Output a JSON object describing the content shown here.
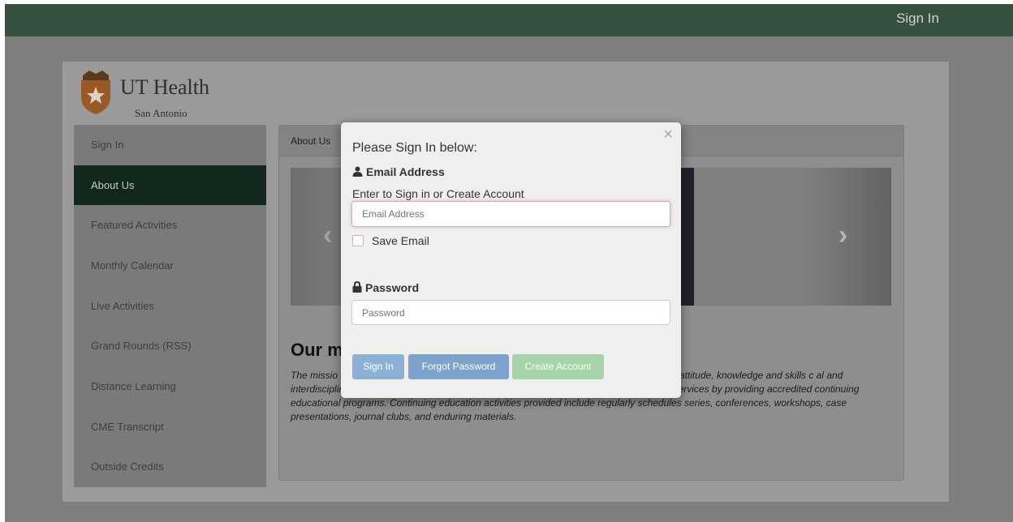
{
  "topbar": {
    "signin_label": "Sign In"
  },
  "logo": {
    "title": "UT Health",
    "subtitle": "San Antonio"
  },
  "sidebar": {
    "items": [
      {
        "label": "Sign In",
        "active": false
      },
      {
        "label": "About Us",
        "active": true
      },
      {
        "label": "Featured Activities",
        "active": false
      },
      {
        "label": "Monthly Calendar",
        "active": false
      },
      {
        "label": "Live Activities",
        "active": false
      },
      {
        "label": "Grand Rounds (RSS)",
        "active": false
      },
      {
        "label": "Distance Learning",
        "active": false
      },
      {
        "label": "CME Transcript",
        "active": false
      },
      {
        "label": "Outside Credits",
        "active": false
      }
    ]
  },
  "panel": {
    "heading": "About Us",
    "mission_title": "Our m",
    "mission_text": "The missio                                                                                    ng School of Medicine CME program is to assume lea                                                                            ning and enhancing the attitude, knowledge and skills c                                                                        al and interdisciplinary settings, to improve patient care through teaching, research, and clinical services by providing accredited continuing educational programs. Continuing education activities provided include regularly schedules series, conferences, workshops, case presentations, journal clubs, and enduring materials."
  },
  "modal": {
    "close_symbol": "×",
    "title": "Please Sign In below:",
    "email_label": "Email Address",
    "email_help": "Enter to Sign in or Create Account",
    "email_placeholder": "Email Address",
    "email_value": "",
    "save_email_label": "Save Email",
    "save_email_checked": false,
    "password_label": "Password",
    "password_placeholder": "Password",
    "buttons": {
      "signin": "Sign In",
      "forgot": "Forgot Password",
      "create": "Create Account"
    }
  },
  "icons": {
    "carousel_prev": "chevron-left-icon",
    "carousel_next": "chevron-right-icon",
    "email": "user-icon",
    "password": "lock-icon",
    "logo": "shield-star-icon"
  },
  "colors": {
    "topbar": "#37513f",
    "active_sidebar": "#13281d",
    "btn_primary": "#7da3cc",
    "btn_success": "#a6d3a8"
  }
}
